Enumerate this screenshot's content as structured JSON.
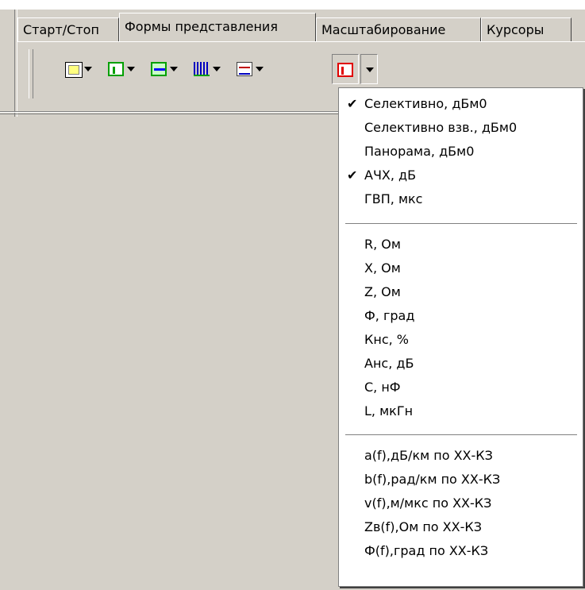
{
  "tabs": [
    {
      "label": "Старт/Стоп",
      "active": false
    },
    {
      "label": "Формы представления",
      "active": true
    },
    {
      "label": "Масштабирование",
      "active": false
    },
    {
      "label": "Курсоры",
      "active": false
    }
  ],
  "toolbar": {
    "buttons": [
      {
        "icon": "wizard-icon"
      },
      {
        "icon": "spectrum-green-icon"
      },
      {
        "icon": "panorama-icon"
      },
      {
        "icon": "bar-spectrum-icon"
      },
      {
        "icon": "multi-graph-icon"
      },
      {
        "icon": "frequency-response-red-icon"
      }
    ]
  },
  "menu": {
    "group1": [
      {
        "label": "Селективно, дБм0",
        "checked": true
      },
      {
        "label": "Селективно взв., дБм0",
        "checked": false
      },
      {
        "label": "Панорама, дБм0",
        "checked": false
      },
      {
        "label": "АЧХ, дБ",
        "checked": true
      },
      {
        "label": "ГВП, мкс",
        "checked": false
      }
    ],
    "group2": [
      {
        "label": "R, Ом"
      },
      {
        "label": "X, Ом"
      },
      {
        "label": "Z, Ом"
      },
      {
        "label": "Ф, град"
      },
      {
        "label": "Кнс, %"
      },
      {
        "label": "Анс, дБ"
      },
      {
        "label": "С, нФ"
      },
      {
        "label": "L, мкГн"
      }
    ],
    "group3": [
      {
        "label": "a(f),дБ/км по ХХ-КЗ"
      },
      {
        "label": "b(f),рад/км по ХХ-КЗ"
      },
      {
        "label": "v(f),м/мкс по ХХ-КЗ"
      },
      {
        "label": "Zв(f),Ом по ХХ-КЗ"
      },
      {
        "label": "Ф(f),град по ХХ-КЗ"
      }
    ],
    "check_glyph": "✔"
  },
  "colors": {
    "face": "#d4d0c8",
    "menu_bg": "#ffffff"
  }
}
